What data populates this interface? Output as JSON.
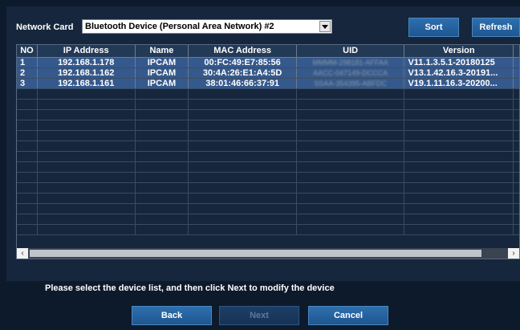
{
  "network_card": {
    "label": "Network Card",
    "selected": "Bluetooth Device (Personal Area Network) #2"
  },
  "toolbar": {
    "sort_label": "Sort",
    "refresh_label": "Refresh"
  },
  "table": {
    "headers": [
      "NO",
      "IP Address",
      "Name",
      "MAC Address",
      "UID",
      "Version"
    ],
    "rows": [
      {
        "no": "1",
        "ip": "192.168.1.178",
        "name": "IPCAM",
        "mac": "00:FC:49:E7:85:56",
        "uid": "MMMM-298181-AFFAA",
        "version": "V11.1.3.5.1-20180125"
      },
      {
        "no": "2",
        "ip": "192.168.1.162",
        "name": "IPCAM",
        "mac": "30:4A:26:E1:A4:5D",
        "uid": "AACC-047149-DCCCA",
        "version": "V13.1.42.16.3-20191..."
      },
      {
        "no": "3",
        "ip": "192.168.1.161",
        "name": "IPCAM",
        "mac": "38:01:46:66:37:91",
        "uid": "SSAA-354395-ABFDC",
        "version": "V19.1.11.16.3-20200..."
      }
    ]
  },
  "footer": {
    "info_text": "Please select the device list, and then click Next to modify the device",
    "back_label": "Back",
    "next_label": "Next",
    "cancel_label": "Cancel"
  }
}
